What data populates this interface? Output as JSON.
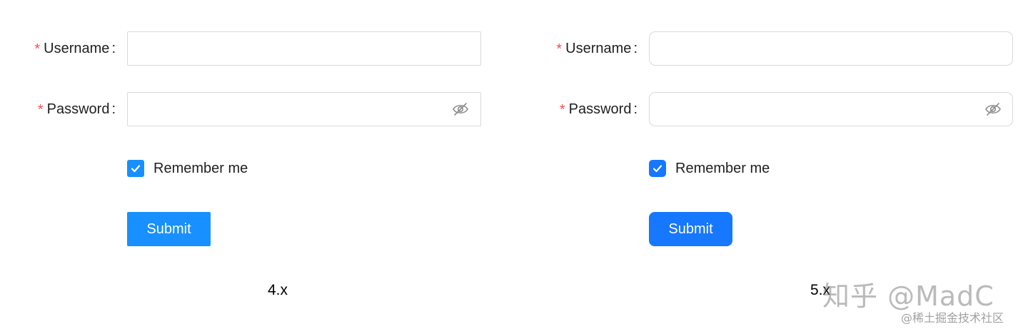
{
  "forms": [
    {
      "username_label": "Username",
      "password_label": "Password",
      "required_mark": "*",
      "colon": ":",
      "remember_label": "Remember me",
      "remember_checked": true,
      "submit_label": "Submit",
      "caption": "4.x",
      "primary_color": "#1890ff"
    },
    {
      "username_label": "Username",
      "password_label": "Password",
      "required_mark": "*",
      "colon": ":",
      "remember_label": "Remember me",
      "remember_checked": true,
      "submit_label": "Submit",
      "caption": "5.x",
      "primary_color": "#1677ff"
    }
  ],
  "watermark": {
    "main": "知乎 @MadC",
    "sub": "@稀土掘金技术社区"
  },
  "colors": {
    "required": "#ff4d4f",
    "border": "#d9d9d9"
  }
}
